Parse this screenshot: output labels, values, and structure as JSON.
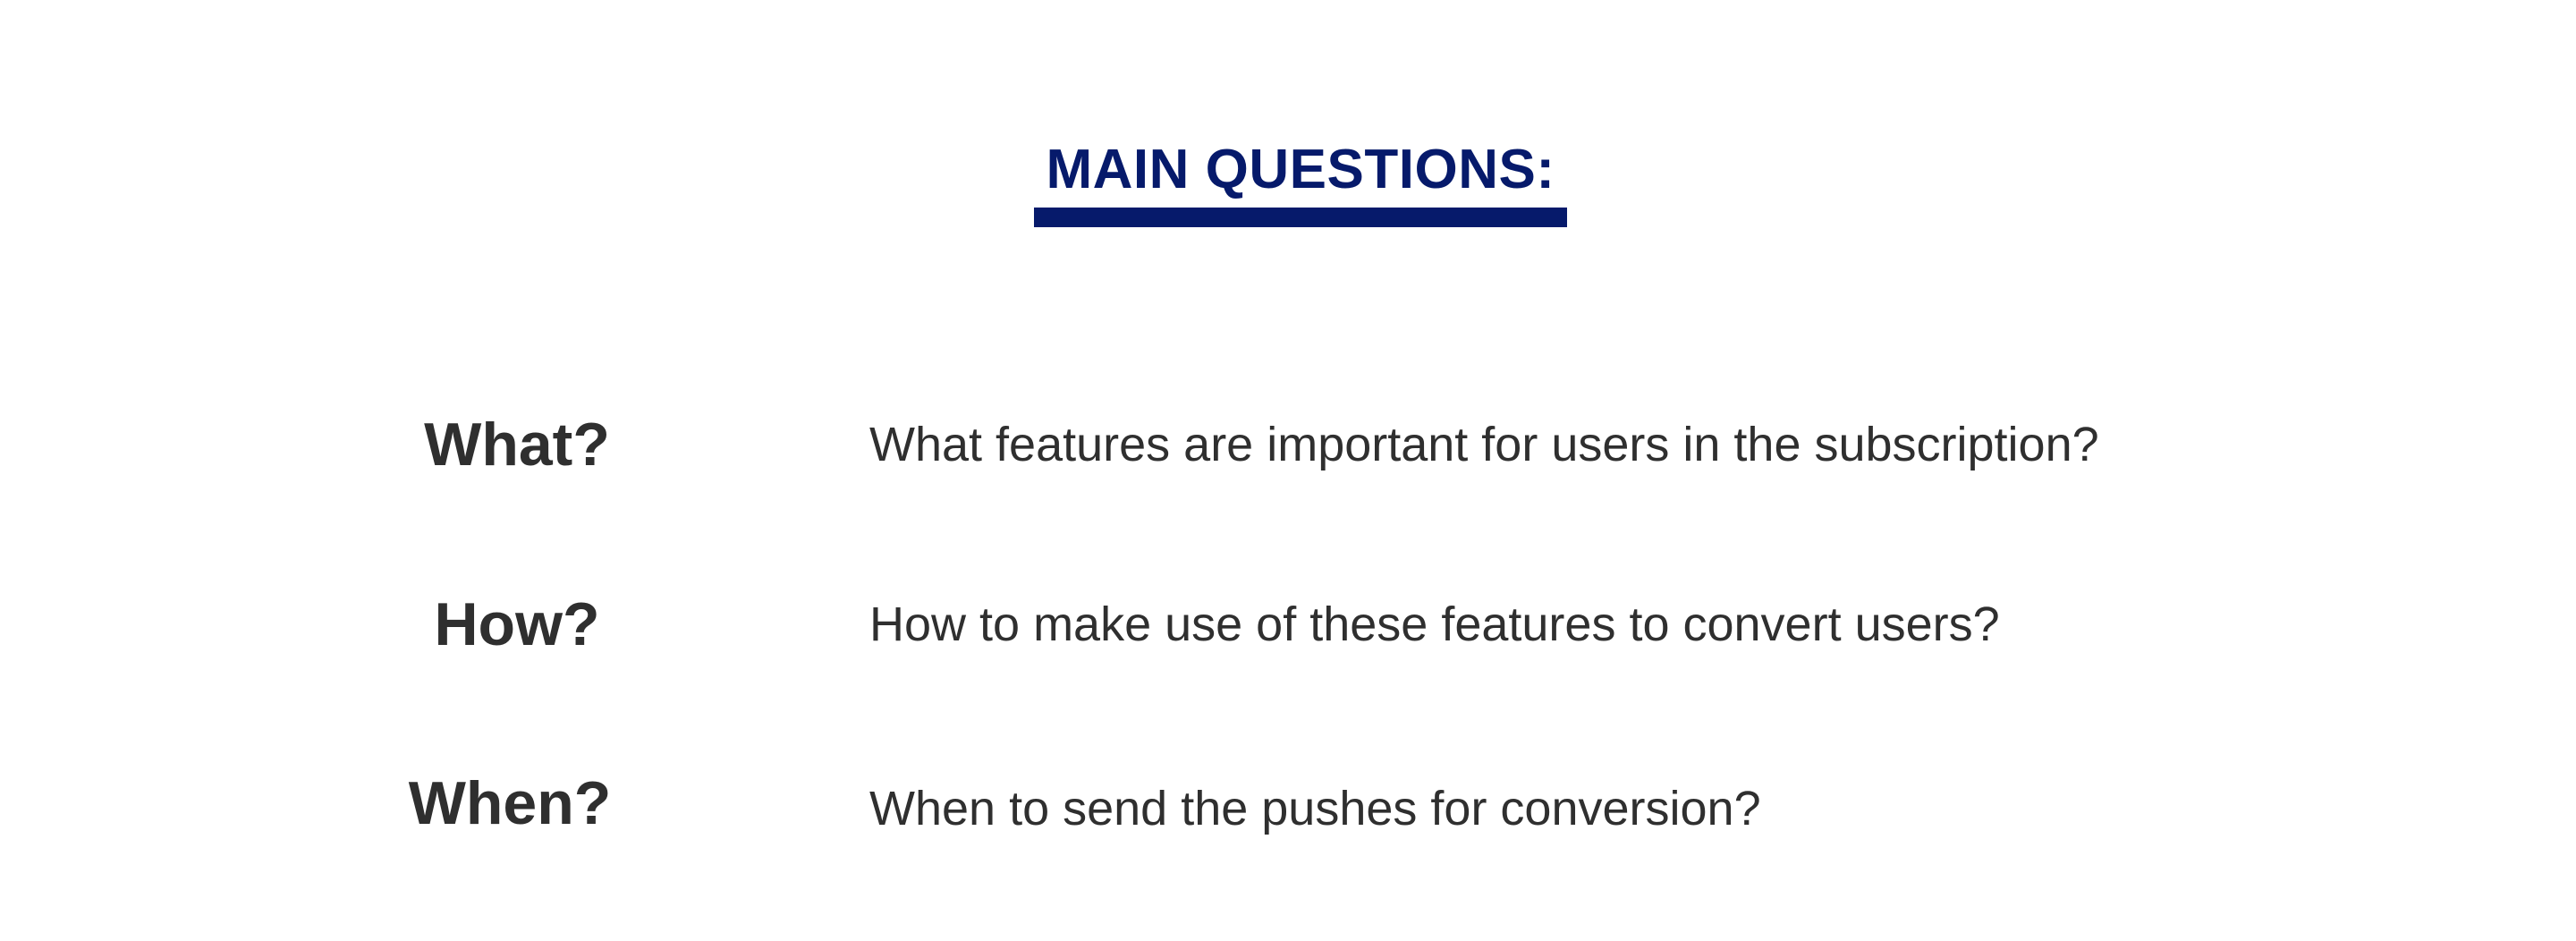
{
  "heading": {
    "title": "MAIN QUESTIONS:",
    "color": "#061a6b"
  },
  "questions": [
    {
      "key": "What?",
      "text": "What features are important for users in the subscription?"
    },
    {
      "key": "How?",
      "text": "How to make use of these features to convert users?"
    },
    {
      "key": "When?",
      "text": "When to send the pushes for conversion?"
    }
  ],
  "colors": {
    "accent": "#061a6b",
    "text": "#2f2f2f",
    "background": "#ffffff"
  }
}
